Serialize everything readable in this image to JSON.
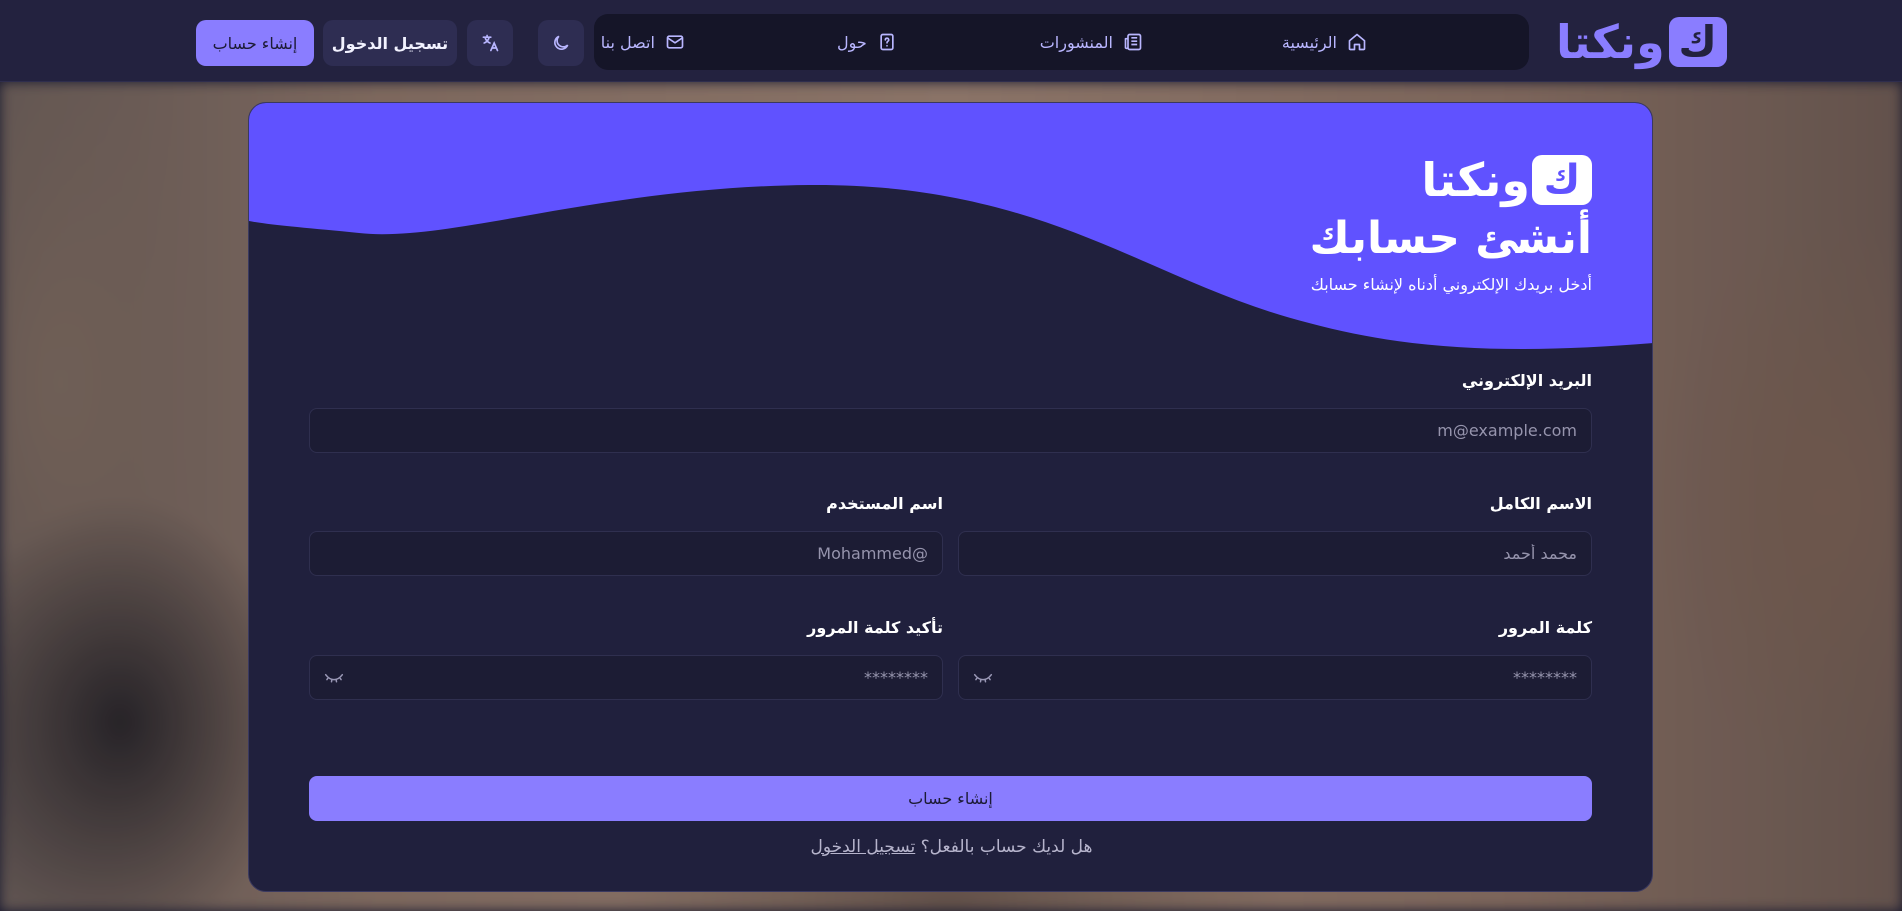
{
  "header": {
    "logo_text": "ونكتا",
    "logo_mark": "ك",
    "nav": [
      {
        "label": "الرئيسية",
        "icon": "home-icon"
      },
      {
        "label": "المنشورات",
        "icon": "newspaper-icon"
      },
      {
        "label": "حول",
        "icon": "help-icon"
      },
      {
        "label": "اتصل بنا",
        "icon": "mail-icon"
      }
    ],
    "theme_icon": "moon-icon",
    "language_icon": "translate-icon",
    "login_label": "تسجيل الدخول",
    "signup_label": "إنشاء حساب"
  },
  "card": {
    "logo_text": "ونكتا",
    "logo_mark": "ك",
    "title": "أنشئ حسابك",
    "subtitle": "أدخل بريدك الإلكتروني أدناه لإنشاء حسابك",
    "email": {
      "label": "البريد الإلكتروني",
      "placeholder": "m@example.com"
    },
    "fullname": {
      "label": "الاسم الكامل",
      "placeholder": "محمد أحمد"
    },
    "username": {
      "label": "اسم المستخدم",
      "placeholder": "@Mohammed"
    },
    "password": {
      "label": "كلمة المرور",
      "placeholder": "********"
    },
    "confirm_password": {
      "label": "تأكيد كلمة المرور",
      "placeholder": "********"
    },
    "submit_label": "إنشاء حساب",
    "footer_question": "هل لديك حساب بالفعل؟",
    "footer_link": "تسجيل الدخول"
  },
  "colors": {
    "accent": "#8a7dff",
    "wave": "#6052ff",
    "header_bg": "#23223f",
    "card_bg": "#20203d"
  }
}
